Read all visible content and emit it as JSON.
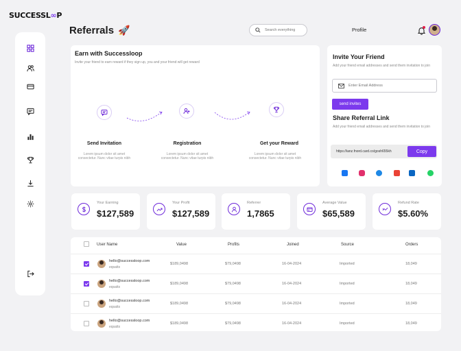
{
  "brand": {
    "name_a": "SUCCESSL",
    "name_b": "∞",
    "name_c": "P"
  },
  "sidebar": {
    "items": [
      {
        "icon": "dashboard-icon"
      },
      {
        "icon": "users-icon"
      },
      {
        "icon": "card-icon"
      },
      {
        "icon": "chat-icon"
      },
      {
        "icon": "chart-icon"
      },
      {
        "icon": "trophy-icon"
      },
      {
        "icon": "download-icon"
      },
      {
        "icon": "gear-icon"
      },
      {
        "icon": "logout-icon"
      }
    ]
  },
  "header": {
    "title": "Referrals",
    "title_emoji": "🚀",
    "search_placeholder": "Search everything",
    "profile_label": "Profile"
  },
  "earn": {
    "title": "Earn with Successloop",
    "subtitle": "Invite your friend to earn reward if they sign up, you and your friend will get reward",
    "steps": [
      {
        "title": "Send Invitation",
        "desc1": "Lorem ipsum dolor sit amet",
        "desc2": "consectetur. Nunc vitae turpis nibh",
        "icon": "message-icon"
      },
      {
        "title": "Registration",
        "desc1": "Lorem ipsum dolor sit amet",
        "desc2": "consectetur. Nunc vitae turpis nibh",
        "icon": "user-add-icon"
      },
      {
        "title": "Get your Reward",
        "desc1": "Lorem ipsum dolor sit amet",
        "desc2": "consectetur. Nunc vitae turpis nibh",
        "icon": "trophy-icon"
      }
    ]
  },
  "invite": {
    "title": "Invite Your Friend",
    "subtitle": "Add your friend email addresses and send them invitation to join",
    "email_placeholder": "Enter Email Address",
    "send_label": "send invites",
    "share_title": "Share Referral Link",
    "share_subtitle": "Add your friend email addresses and send them invitation to join",
    "link": "https://ianz.fnord.card.co/gosh655kh",
    "copy_label": "Copy",
    "socials": [
      "facebook-icon",
      "instagram-icon",
      "messenger-icon",
      "gmail-icon",
      "linkedin-icon",
      "whatsapp-icon"
    ]
  },
  "stats": [
    {
      "label": "Your Earning",
      "value": "$127,589",
      "icon": "dollar-icon"
    },
    {
      "label": "Your Profit",
      "value": "$127,589",
      "icon": "trend-icon"
    },
    {
      "label": "Referrer",
      "value": "1,7865",
      "icon": "user-icon"
    },
    {
      "label": "Average Value",
      "value": "$65,589",
      "icon": "wallet-icon"
    },
    {
      "label": "Refund Rate",
      "value": "$5.60%",
      "icon": "refund-icon"
    }
  ],
  "table": {
    "headers": [
      "User Name",
      "Value",
      "Profits",
      "Joined",
      "Source",
      "Orders"
    ],
    "rows": [
      {
        "checked": true,
        "email": "hello@successloop.com",
        "handle": "eqsattx",
        "value": "$189,0498",
        "profits": "$79,0498",
        "joined": "16-04-2024",
        "source": "Imported",
        "orders": "18,049"
      },
      {
        "checked": true,
        "email": "hello@successloop.com",
        "handle": "eqsattx",
        "value": "$189,0498",
        "profits": "$79,0498",
        "joined": "16-04-2024",
        "source": "Imported",
        "orders": "18,049"
      },
      {
        "checked": false,
        "email": "hello@successloop.com",
        "handle": "eqsattx",
        "value": "$189,0498",
        "profits": "$79,0498",
        "joined": "16-04-2024",
        "source": "Imported",
        "orders": "18,049"
      },
      {
        "checked": false,
        "email": "hello@successloop.com",
        "handle": "eqsattx",
        "value": "$189,0498",
        "profits": "$79,0498",
        "joined": "16-04-2024",
        "source": "Imported",
        "orders": "18,049"
      }
    ]
  },
  "colors": {
    "accent": "#7c3aed",
    "background": "#f2f2f4"
  }
}
